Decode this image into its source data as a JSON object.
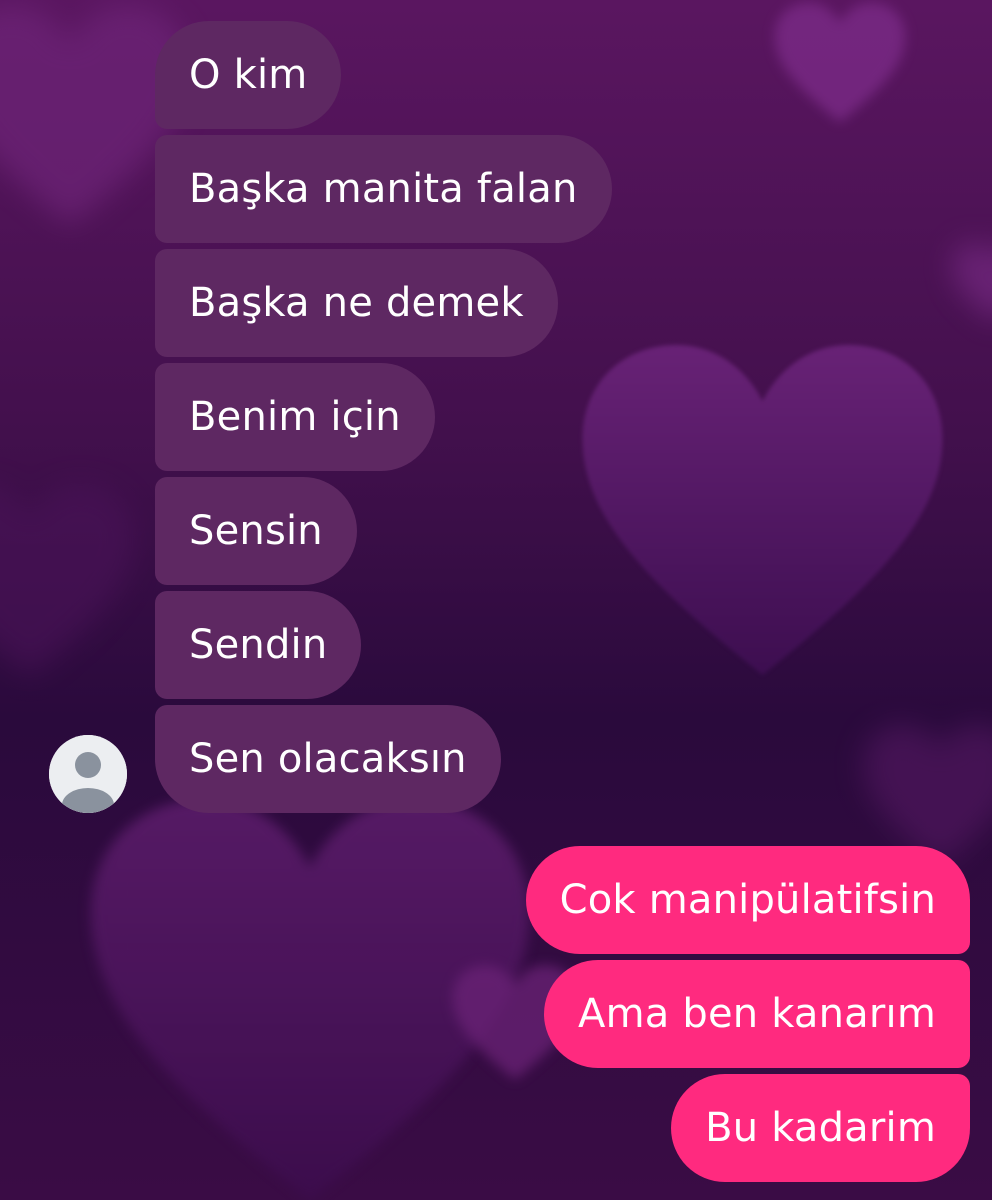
{
  "chat": {
    "incoming": [
      {
        "text": "O kim"
      },
      {
        "text": "Başka manita falan"
      },
      {
        "text": "Başka ne demek"
      },
      {
        "text": "Benim için"
      },
      {
        "text": "Sensin"
      },
      {
        "text": "Sendin"
      },
      {
        "text": "Sen olacaksın"
      }
    ],
    "outgoing": [
      {
        "text": "Cok manipülatifsin"
      },
      {
        "text": "Ama ben kanarım"
      },
      {
        "text": "Bu kadarim"
      }
    ]
  },
  "icons": {
    "avatar": "default-user-avatar-icon",
    "background": "heart-icon"
  },
  "colors": {
    "incoming_bubble": "#5e2862",
    "outgoing_bubble": "#ff2a7f",
    "text": "#ffffff"
  }
}
